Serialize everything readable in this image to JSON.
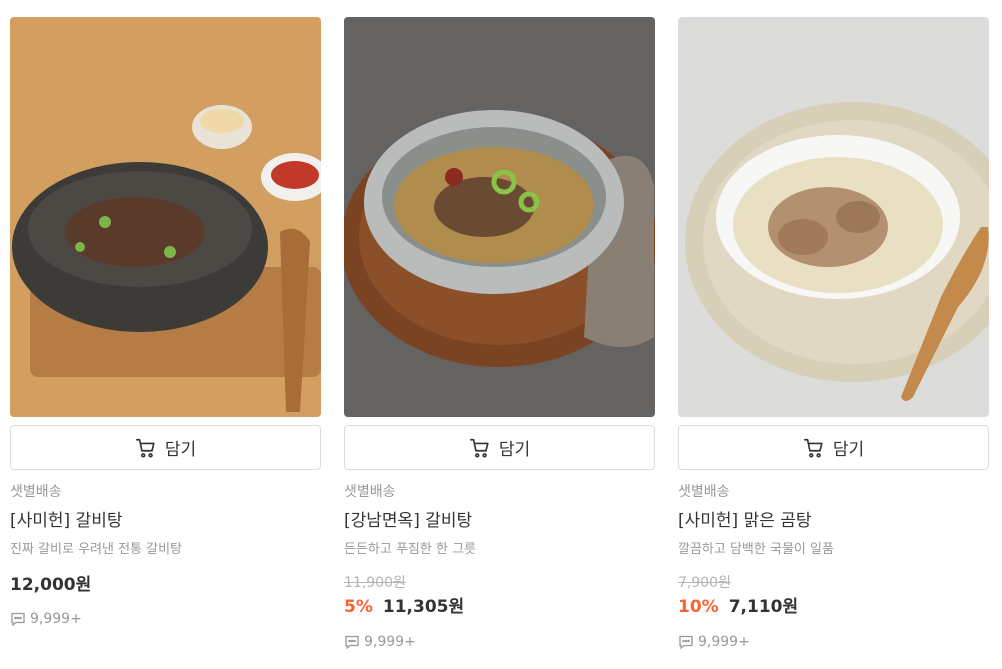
{
  "colors": {
    "discount": "#fa622f",
    "muted": "#999999",
    "border": "#dcdcdc"
  },
  "icons": {
    "cart": "cart-icon",
    "review": "speech-bubble-icon"
  },
  "products": [
    {
      "image_desc": "beef short rib soup in dark bowl",
      "cart_label": "담기",
      "delivery": "샛별배송",
      "name": "[사미헌] 갈비탕",
      "description": "진짜 갈비로 우려낸 전통 갈비탕",
      "price": "12,000원",
      "reviews": "9,999+"
    },
    {
      "image_desc": "short rib soup in grey bowl on wooden plate",
      "cart_label": "담기",
      "delivery": "샛별배송",
      "name": "[강남면옥] 갈비탕",
      "description": "든든하고 푸짐한 한 그릇",
      "original_price": "11,900원",
      "discount": "5%",
      "price": "11,305원",
      "reviews": "9,999+"
    },
    {
      "image_desc": "clear beef bone soup in white bowl",
      "cart_label": "담기",
      "delivery": "샛별배송",
      "name": "[사미헌] 맑은 곰탕",
      "description": "깔끔하고 담백한 국물이 일품",
      "original_price": "7,900원",
      "discount": "10%",
      "price": "7,110원",
      "reviews": "9,999+"
    }
  ]
}
